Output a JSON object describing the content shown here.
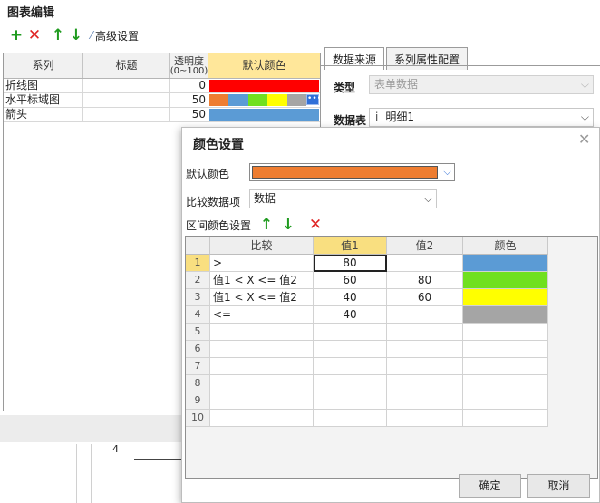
{
  "window": {
    "title": "图表编辑"
  },
  "toolbar": {
    "add_glyph": "+",
    "delete_glyph": "✕",
    "up_glyph": "↑",
    "down_glyph": "↓",
    "advanced_label": "高级设置",
    "advanced_icon": "magic-wand-icon"
  },
  "series_table": {
    "headers": [
      "系列",
      "标题",
      "透明度",
      "(0~100)",
      "默认颜色"
    ],
    "rows": [
      {
        "series": "折线图",
        "title": "",
        "opacity": "0"
      },
      {
        "series": "水平标域图",
        "title": "",
        "opacity": "50"
      },
      {
        "series": "箭头",
        "title": "",
        "opacity": "50"
      }
    ],
    "row_colors": [
      [
        "#ff0000"
      ],
      [
        "#ee7d31",
        "#5b9bd5",
        "#70e01f",
        "#ffff00",
        "#a5a5a5"
      ],
      [
        "#5b9bd5"
      ]
    ],
    "more_glyph": "•••"
  },
  "right_panel": {
    "tabs": [
      "数据来源",
      "系列属性配置"
    ],
    "type_label": "类型",
    "type_value": "表单数据",
    "table_label": "数据表",
    "table_value": "明细1",
    "table_marker": "i"
  },
  "bottom": {
    "number": "4"
  },
  "dialog": {
    "title": "颜色设置",
    "close_glyph": "✕",
    "default_color_label": "默认颜色",
    "default_color": "#ee7d31",
    "compare_label": "比较数据项",
    "compare_value": "数据",
    "range_label": "区间颜色设置",
    "grid": {
      "headers": [
        "",
        "比较",
        "值1",
        "值2",
        "颜色"
      ],
      "rows": [
        {
          "n": "1",
          "cmp": ">",
          "v1": "80",
          "v2": "",
          "color": "#5b9bd5"
        },
        {
          "n": "2",
          "cmp": "值1 < X <= 值2",
          "v1": "60",
          "v2": "80",
          "color": "#70e01f"
        },
        {
          "n": "3",
          "cmp": "值1 < X <= 值2",
          "v1": "40",
          "v2": "60",
          "color": "#ffff00"
        },
        {
          "n": "4",
          "cmp": "<=",
          "v1": "40",
          "v2": "",
          "color": "#a5a5a5"
        },
        {
          "n": "5",
          "cmp": "",
          "v1": "",
          "v2": "",
          "color": ""
        },
        {
          "n": "6",
          "cmp": "",
          "v1": "",
          "v2": "",
          "color": ""
        },
        {
          "n": "7",
          "cmp": "",
          "v1": "",
          "v2": "",
          "color": ""
        },
        {
          "n": "8",
          "cmp": "",
          "v1": "",
          "v2": "",
          "color": ""
        },
        {
          "n": "9",
          "cmp": "",
          "v1": "",
          "v2": "",
          "color": ""
        },
        {
          "n": "10",
          "cmp": "",
          "v1": "",
          "v2": "",
          "color": ""
        }
      ]
    },
    "ok_label": "确定",
    "cancel_label": "取消"
  }
}
